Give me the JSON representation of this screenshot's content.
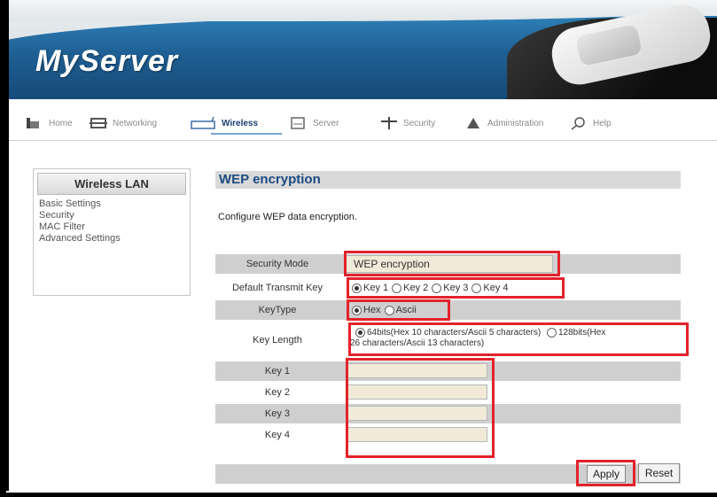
{
  "brand": {
    "logo": "MyServer"
  },
  "nav": [
    {
      "label": "Home",
      "icon": "home-icon"
    },
    {
      "label": "Networking",
      "icon": "network-icon"
    },
    {
      "label": "Wireless",
      "icon": "wireless-icon"
    },
    {
      "label": "Server",
      "icon": "server-icon"
    },
    {
      "label": "Security",
      "icon": "security-icon"
    },
    {
      "label": "Administration",
      "icon": "admin-icon"
    },
    {
      "label": "Help",
      "icon": "search-icon"
    }
  ],
  "sidebar": {
    "title": "Wireless LAN",
    "links": [
      "Basic Settings",
      "Security",
      "MAC Filter",
      "Advanced Settings"
    ]
  },
  "main": {
    "title": "WEP encryption",
    "description": "Configure WEP data encryption.",
    "security_mode": {
      "label": "Security Mode",
      "value": "WEP encryption"
    },
    "default_key": {
      "label": "Default Transmit Key",
      "options": [
        "Key 1",
        "Key 2",
        "Key 3",
        "Key 4"
      ],
      "selected": "Key 1"
    },
    "key_type": {
      "label": "KeyType",
      "options": [
        "Hex",
        "Ascii"
      ],
      "selected": "Hex"
    },
    "key_length": {
      "label": "Key Length",
      "option1": "64bits(Hex 10 characters/Ascii 5 characters)",
      "option2_line1": "128bits(Hex",
      "option2_line2": "26 characters/Ascii 13 characters)",
      "selected": "64bits"
    },
    "keys": [
      {
        "label": "Key 1",
        "value": ""
      },
      {
        "label": "Key 2",
        "value": ""
      },
      {
        "label": "Key 3",
        "value": ""
      },
      {
        "label": "Key 4",
        "value": ""
      }
    ],
    "apply_label": "Apply",
    "reset_label": "Reset"
  },
  "colors": {
    "highlight": "#e2232b",
    "title_text": "#1c4a80",
    "header_blue": "#1f5f93"
  }
}
